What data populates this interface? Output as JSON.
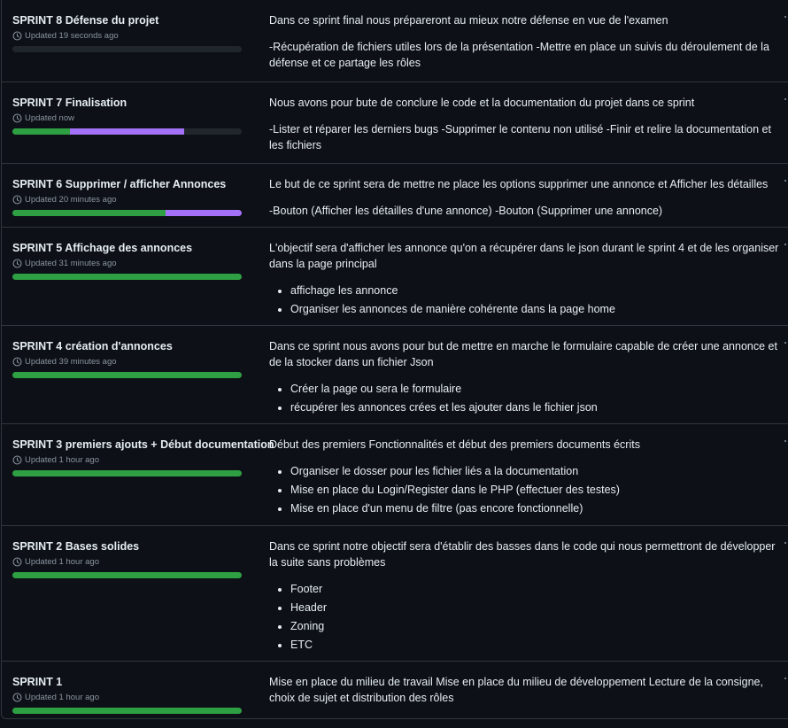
{
  "colors": {
    "done": "#2ea043",
    "in_progress": "#a371f7",
    "track": "#21262d"
  },
  "milestones": [
    {
      "title": "SPRINT 8 Défense du projet",
      "updated": "Updated 19 seconds ago",
      "progress": {
        "done": 0.0,
        "in_progress": 0.0
      },
      "paragraphs": [
        "Dans ce sprint final nous prépareront au mieux notre défense en vue de l'examen",
        "-Récupération de fichiers utiles lors de la présentation -Mettre en place un suivis du déroulement de la défense et ce partage les rôles"
      ],
      "bullets": []
    },
    {
      "title": "SPRINT 7 Finalisation",
      "updated": "Updated now",
      "progress": {
        "done": 0.25,
        "in_progress": 0.5
      },
      "paragraphs": [
        "Nous avons pour bute de conclure le code et la documentation du projet dans ce sprint",
        "-Lister et réparer les derniers bugs -Supprimer le contenu non utilisé -Finir et relire la documentation et les fichiers"
      ],
      "bullets": []
    },
    {
      "title": "SPRINT 6 Supprimer / afficher Annonces",
      "updated": "Updated 20 minutes ago",
      "progress": {
        "done": 0.667,
        "in_progress": 0.333
      },
      "paragraphs": [
        "Le but de ce sprint sera de mettre ne place les options supprimer une annonce et Afficher les détailles",
        "-Bouton (Afficher les détailles d'une annonce) -Bouton (Supprimer une annonce)"
      ],
      "bullets": []
    },
    {
      "title": "SPRINT 5 Affichage des annonces",
      "updated": "Updated 31 minutes ago",
      "progress": {
        "done": 1.0,
        "in_progress": 0.0
      },
      "paragraphs": [
        "L'objectif sera d'afficher les annonce qu'on a récupérer dans le json durant le sprint 4 et de les organiser dans la page principal"
      ],
      "bullets": [
        "affichage les annonce",
        "Organiser les annonces de manière cohérente dans la page home"
      ]
    },
    {
      "title": "SPRINT 4 création d'annonces",
      "updated": "Updated 39 minutes ago",
      "progress": {
        "done": 1.0,
        "in_progress": 0.0
      },
      "paragraphs": [
        "Dans ce sprint nous avons pour but de mettre en marche le formulaire capable de créer une annonce et de la stocker dans un fichier Json"
      ],
      "bullets": [
        "Créer la page ou sera le formulaire",
        "récupérer les annonces crées et les ajouter dans le fichier json"
      ]
    },
    {
      "title": "SPRINT 3 premiers ajouts + Début documentation",
      "updated": "Updated 1 hour ago",
      "progress": {
        "done": 1.0,
        "in_progress": 0.0
      },
      "paragraphs": [
        "Début des premiers Fonctionnalités et début des premiers documents écrits"
      ],
      "bullets": [
        "Organiser le dosser pour les fichier liés a la documentation",
        "Mise en place du Login/Register dans le PHP (effectuer des testes)",
        "Mise en place d'un menu de filtre (pas encore fonctionnelle)"
      ]
    },
    {
      "title": "SPRINT 2 Bases solides",
      "updated": "Updated 1 hour ago",
      "progress": {
        "done": 1.0,
        "in_progress": 0.0
      },
      "paragraphs": [
        "Dans ce sprint notre objectif sera d'établir des basses dans le code qui nous permettront de développer la suite sans problèmes"
      ],
      "bullets": [
        "Footer",
        "Header",
        "Zoning",
        "ETC"
      ]
    },
    {
      "title": "SPRINT 1",
      "updated": "Updated 1 hour ago",
      "progress": {
        "done": 1.0,
        "in_progress": 0.0
      },
      "paragraphs": [
        "Mise en place du milieu de travail Mise en place du milieu de développement Lecture de la consigne, choix de sujet et distribution des rôles"
      ],
      "bullets": []
    }
  ]
}
